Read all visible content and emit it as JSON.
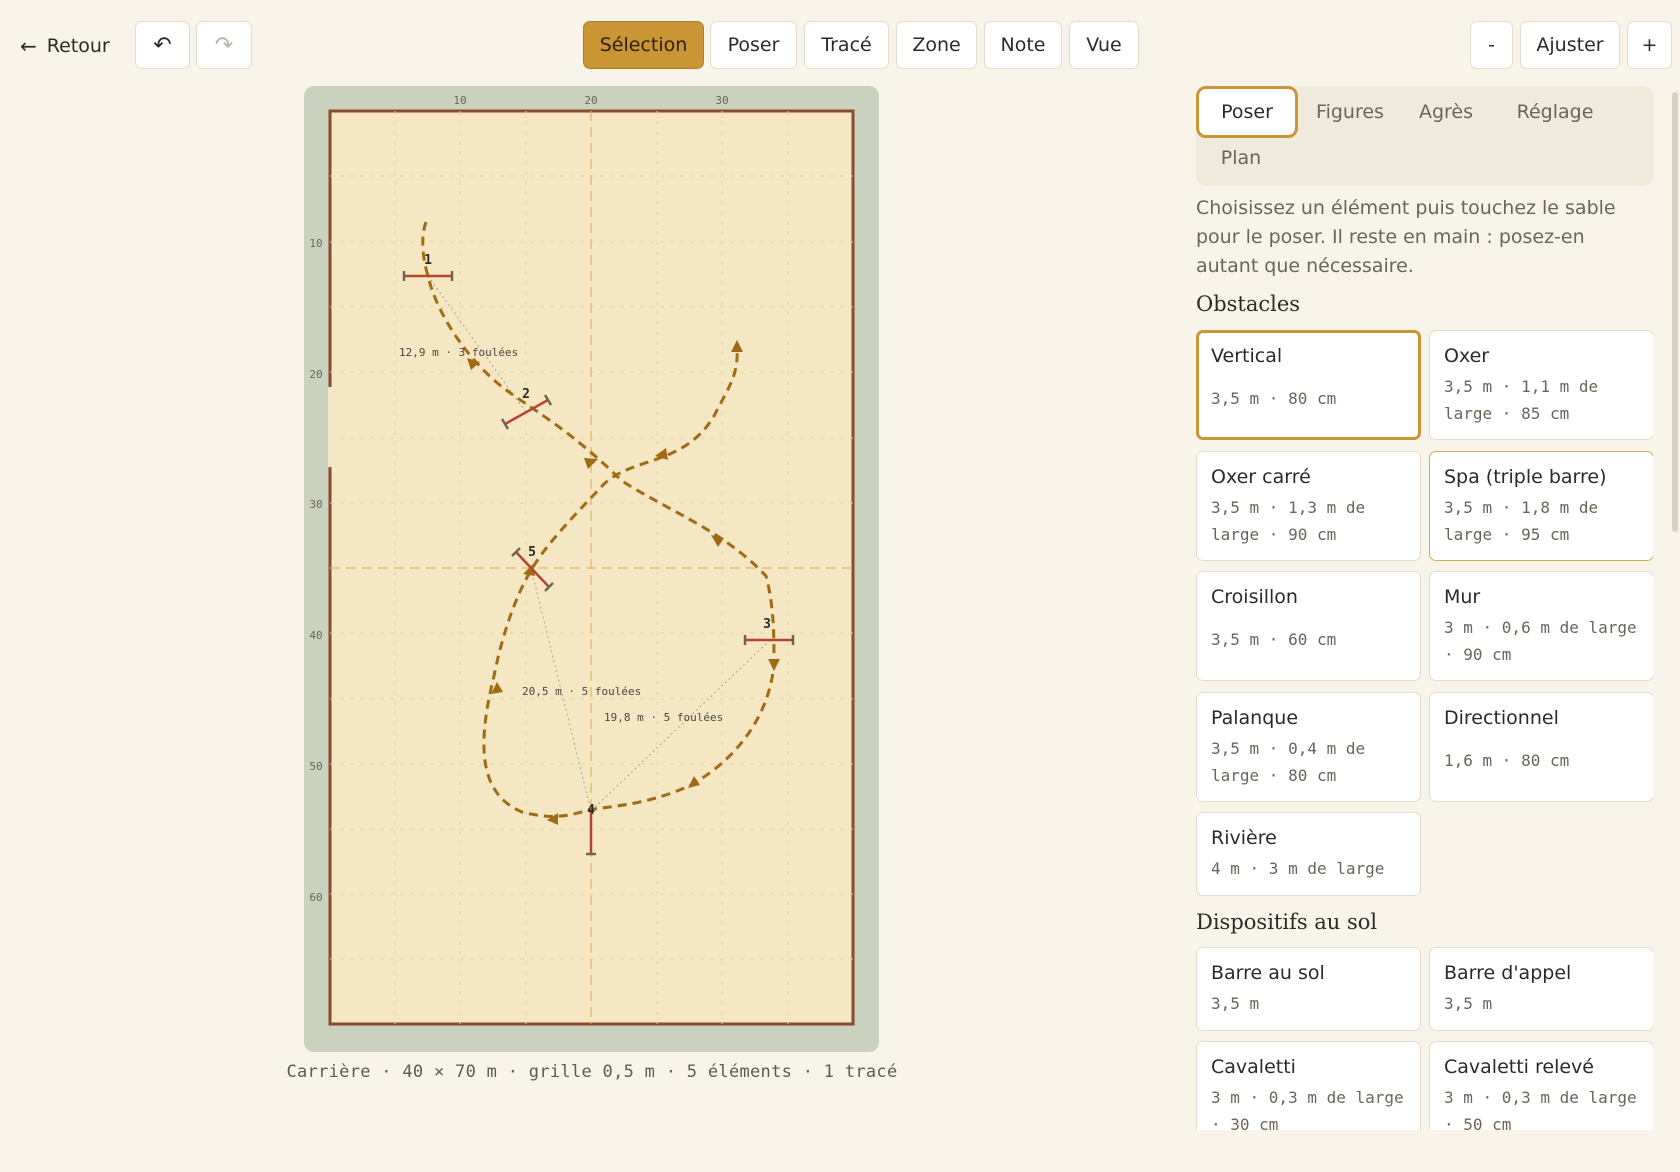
{
  "topbar": {
    "back_label": "Retour",
    "back_icon": "arrow-left-icon",
    "undo_icon": "undo-icon",
    "redo_icon": "redo-icon",
    "modes": [
      "Sélection",
      "Poser",
      "Tracé",
      "Zone",
      "Note",
      "Vue"
    ],
    "active_mode": "Sélection",
    "zoom_out": "-",
    "zoom_fit": "Ajuster",
    "zoom_in": "+"
  },
  "arena": {
    "x_ticks": [
      "10",
      "20",
      "30"
    ],
    "y_ticks": [
      "10",
      "20",
      "30",
      "40",
      "50",
      "60"
    ],
    "obstacles": [
      {
        "number": "1",
        "x": 7.5,
        "y": 12.5
      },
      {
        "number": "2",
        "x": 15,
        "y": 22.5
      },
      {
        "number": "5",
        "x": 15.5,
        "y": 35
      },
      {
        "number": "3",
        "x": 33.5,
        "y": 40.5
      },
      {
        "number": "4",
        "x": 20,
        "y": 56
      }
    ],
    "distances": [
      {
        "label": "12,9 m · 3 foulées"
      },
      {
        "label": "20,5 m · 5 foulées"
      },
      {
        "label": "19,8 m · 5 foulées"
      }
    ],
    "caption": "Carrière · 40 × 70 m · grille 0,5 m · 5 éléments · 1 tracé",
    "colors": {
      "sand": "#f5e7c3",
      "border": "#8a4a2c",
      "path": "#a06b14",
      "obstacle": "#b5442f",
      "surround": "#cad2bd"
    }
  },
  "panel": {
    "tabs": [
      "Poser",
      "Figures",
      "Agrès",
      "Réglage",
      "Plan"
    ],
    "active_tab": "Poser",
    "help": "Choisissez un élément puis touchez le sable pour le poser. Il reste en main : posez-en autant que nécessaire.",
    "obstacles_title": "Obstacles",
    "obstacles": [
      {
        "name": "Vertical",
        "dim": "3,5 m · 80 cm"
      },
      {
        "name": "Oxer",
        "dim": "3,5 m · 1,1 m de large · 85 cm"
      },
      {
        "name": "Oxer carré",
        "dim": "3,5 m · 1,3 m de large · 90 cm"
      },
      {
        "name": "Spa (triple barre)",
        "dim": "3,5 m · 1,8 m de large · 95 cm"
      },
      {
        "name": "Croisillon",
        "dim": "3,5 m · 60 cm"
      },
      {
        "name": "Mur",
        "dim": "3 m · 0,6 m de large · 90 cm"
      },
      {
        "name": "Palanque",
        "dim": "3,5 m · 0,4 m de large · 80 cm"
      },
      {
        "name": "Directionnel",
        "dim": "1,6 m · 80 cm"
      },
      {
        "name": "Rivière",
        "dim": "4 m · 3 m de large"
      }
    ],
    "ground_title": "Dispositifs au sol",
    "ground": [
      {
        "name": "Barre au sol",
        "dim": "3,5 m"
      },
      {
        "name": "Barre d'appel",
        "dim": "3,5 m"
      },
      {
        "name": "Cavaletti",
        "dim": "3 m · 0,3 m de large · 30 cm"
      },
      {
        "name": "Cavaletti relevé",
        "dim": "3 m · 0,3 m de large · 50 cm"
      }
    ]
  }
}
